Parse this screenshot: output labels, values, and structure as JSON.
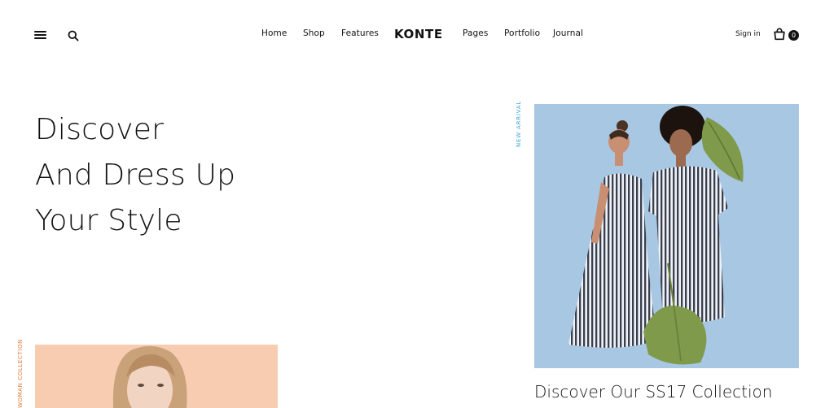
{
  "header": {
    "logo": "KONTE",
    "nav_left": [
      "Home",
      "Shop",
      "Features"
    ],
    "nav_right": [
      "Pages",
      "Portfolio",
      "Journal"
    ],
    "signin": "Sign in",
    "cart_count": "0",
    "icons": [
      "menu-icon",
      "search-icon",
      "shopping-bag-icon"
    ]
  },
  "hero": {
    "title_lines": [
      "Discover",
      "And Dress Up",
      "Your Style"
    ]
  },
  "feature": {
    "label": "NEW ARRIVAL",
    "caption": "Discover Our SS17 Collection",
    "bg_color": "#a7c7e3",
    "label_color": "#3fa6d6"
  },
  "secondary": {
    "label": "WOMAN COLLECTION",
    "bg_color": "#f7ccb1",
    "label_color": "#e0793a"
  }
}
